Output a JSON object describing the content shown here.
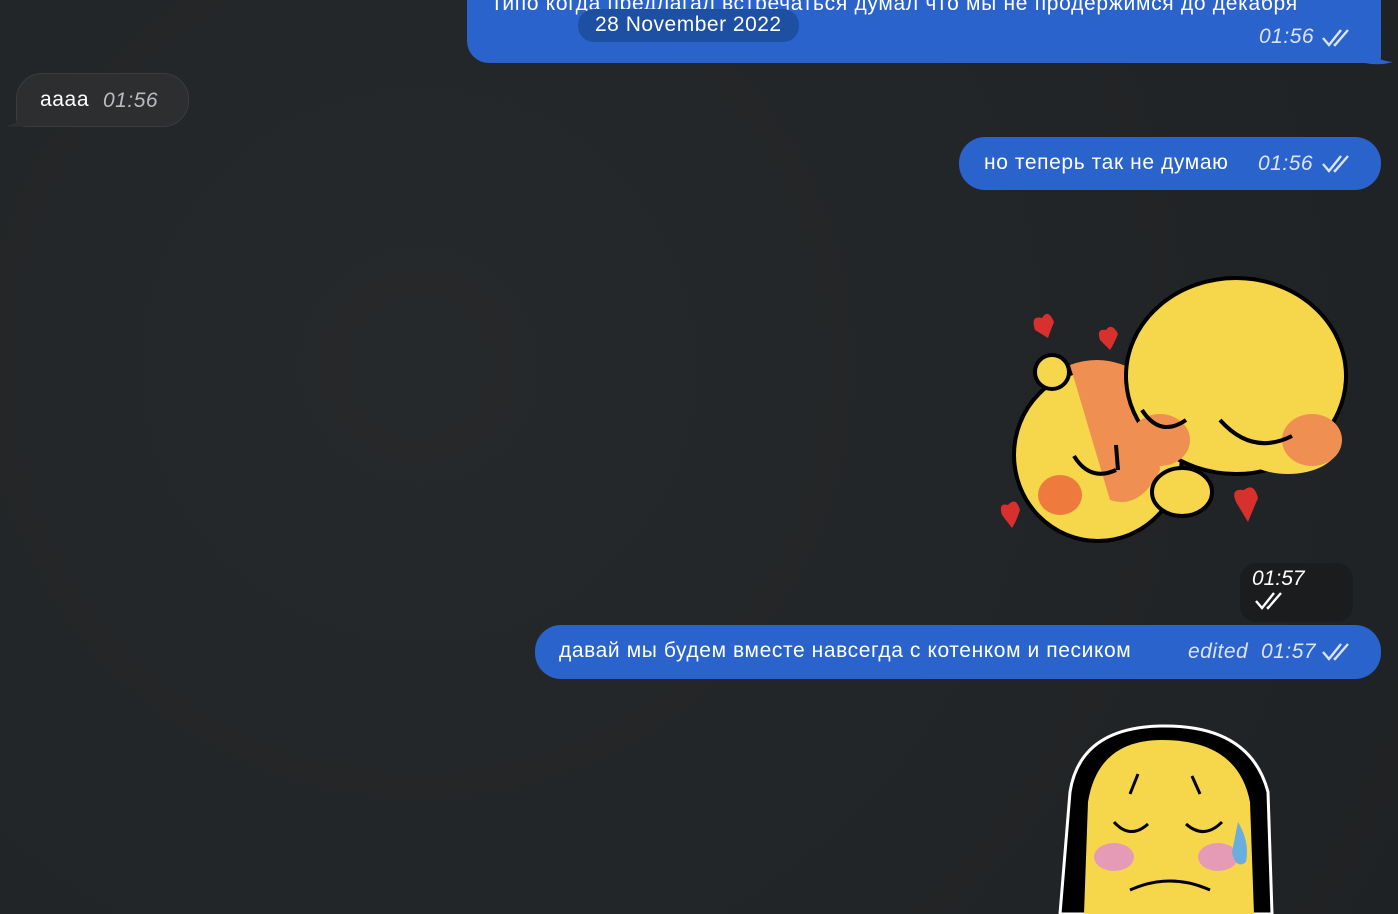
{
  "date_separator": "28 November 2022",
  "messages": [
    {
      "id": "m1",
      "direction": "out",
      "text": "типо когда предлагал встречаться думал что мы не продержимся до декабря",
      "time": "01:56",
      "edited": ""
    },
    {
      "id": "m2",
      "direction": "in",
      "text": "аааа",
      "time": "01:56",
      "edited": ""
    },
    {
      "id": "m3",
      "direction": "out",
      "text": "но теперь так не думаю",
      "time": "01:56",
      "edited": ""
    },
    {
      "id": "m4",
      "direction": "out",
      "type": "sticker",
      "sticker": "hugging-cursed-emoji",
      "time": "01:57"
    },
    {
      "id": "m5",
      "direction": "out",
      "text": "давай мы будем вместе навсегда с котенком и песиком",
      "time": "01:57",
      "edited": "edited"
    },
    {
      "id": "m6",
      "direction": "out",
      "type": "sticker",
      "sticker": "crying-cursed-emoji"
    }
  ],
  "colors": {
    "background": "#222527",
    "outgoing_bubble": "#2a63cb",
    "incoming_bubble": "#2c2e30",
    "date_pill": "#1d4fa3"
  },
  "icons": {
    "read_receipt": "double-check-icon"
  }
}
